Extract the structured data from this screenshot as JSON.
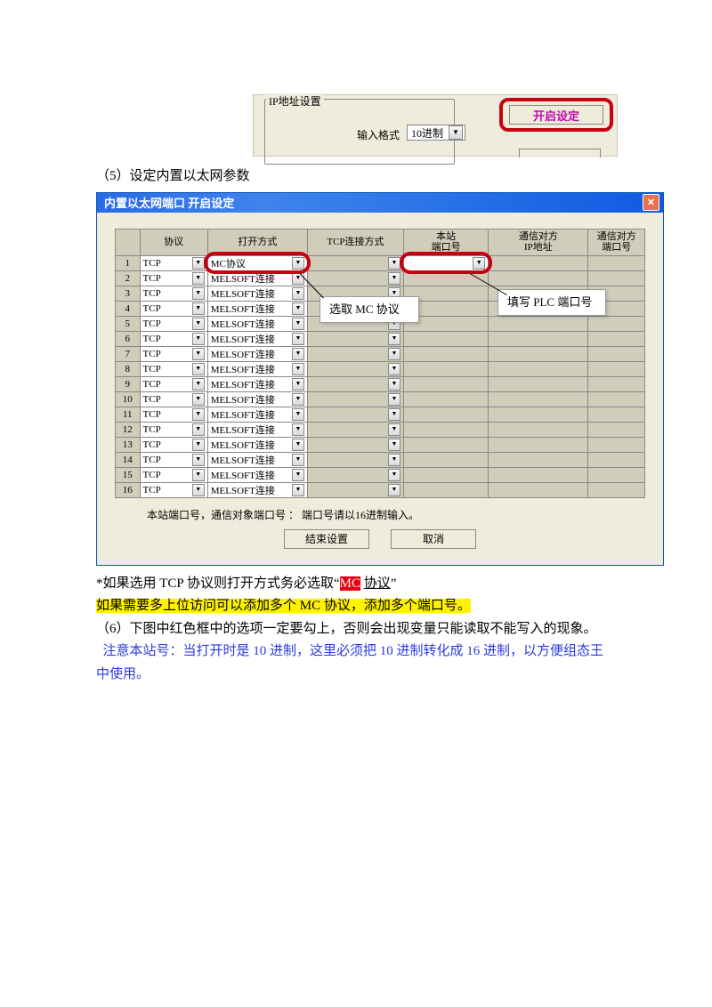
{
  "frag1": {
    "legend": "IP地址设置",
    "input_format_label": "输入格式",
    "input_format_value": "10进制",
    "open_settings_btn": "开启设定"
  },
  "step5": "（5）设定内置以太网参数",
  "dialog": {
    "title": "内置以太网端口  开启设定",
    "headers": [
      "",
      "协议",
      "打开方式",
      "TCP连接方式",
      "本站\n端口号",
      "通信对方\nIP地址",
      "通信对方\n端口号"
    ],
    "rows": [
      {
        "n": "1",
        "proto": "TCP",
        "open": "MC协议",
        "tcp": "",
        "port": "",
        "ip": "",
        "rport": ""
      },
      {
        "n": "2",
        "proto": "TCP",
        "open": "MELSOFT连接",
        "tcp": "",
        "port": "",
        "ip": "",
        "rport": ""
      },
      {
        "n": "3",
        "proto": "TCP",
        "open": "MELSOFT连接",
        "tcp": "",
        "port": "",
        "ip": "",
        "rport": ""
      },
      {
        "n": "4",
        "proto": "TCP",
        "open": "MELSOFT连接",
        "tcp": "",
        "port": "",
        "ip": "",
        "rport": ""
      },
      {
        "n": "5",
        "proto": "TCP",
        "open": "MELSOFT连接",
        "tcp": "",
        "port": "",
        "ip": "",
        "rport": ""
      },
      {
        "n": "6",
        "proto": "TCP",
        "open": "MELSOFT连接",
        "tcp": "",
        "port": "",
        "ip": "",
        "rport": ""
      },
      {
        "n": "7",
        "proto": "TCP",
        "open": "MELSOFT连接",
        "tcp": "",
        "port": "",
        "ip": "",
        "rport": ""
      },
      {
        "n": "8",
        "proto": "TCP",
        "open": "MELSOFT连接",
        "tcp": "",
        "port": "",
        "ip": "",
        "rport": ""
      },
      {
        "n": "9",
        "proto": "TCP",
        "open": "MELSOFT连接",
        "tcp": "",
        "port": "",
        "ip": "",
        "rport": ""
      },
      {
        "n": "10",
        "proto": "TCP",
        "open": "MELSOFT连接",
        "tcp": "",
        "port": "",
        "ip": "",
        "rport": ""
      },
      {
        "n": "11",
        "proto": "TCP",
        "open": "MELSOFT连接",
        "tcp": "",
        "port": "",
        "ip": "",
        "rport": ""
      },
      {
        "n": "12",
        "proto": "TCP",
        "open": "MELSOFT连接",
        "tcp": "",
        "port": "",
        "ip": "",
        "rport": ""
      },
      {
        "n": "13",
        "proto": "TCP",
        "open": "MELSOFT连接",
        "tcp": "",
        "port": "",
        "ip": "",
        "rport": ""
      },
      {
        "n": "14",
        "proto": "TCP",
        "open": "MELSOFT连接",
        "tcp": "",
        "port": "",
        "ip": "",
        "rport": ""
      },
      {
        "n": "15",
        "proto": "TCP",
        "open": "MELSOFT连接",
        "tcp": "",
        "port": "",
        "ip": "",
        "rport": ""
      },
      {
        "n": "16",
        "proto": "TCP",
        "open": "MELSOFT连接",
        "tcp": "",
        "port": "",
        "ip": "",
        "rport": ""
      }
    ],
    "hint": "本站端口号，通信对象端口号 ： 端口号请以16进制输入。",
    "btn_end": "结束设置",
    "btn_cancel": "取消",
    "callout_mc": "选取 MC 协议",
    "callout_plc": "填写 PLC 端口号"
  },
  "notes": {
    "star_prefix": "*如果选用 TCP 协议则打开方式务必选取“",
    "mc": "MC",
    "protocol_word": "协议",
    "quote_end": "”",
    "yellow": "如果需要多上位访问可以添加多个 MC 协议，添加多个端口号。",
    "step6": "（6）下图中红色框中的选项一定要勾上，否则会出现变量只能读取不能写入的现象。",
    "blue": "  注意本站号：当打开时是 10 进制，这里必须把 10 进制转化成 16 进制，以方便组态王中使用。"
  }
}
